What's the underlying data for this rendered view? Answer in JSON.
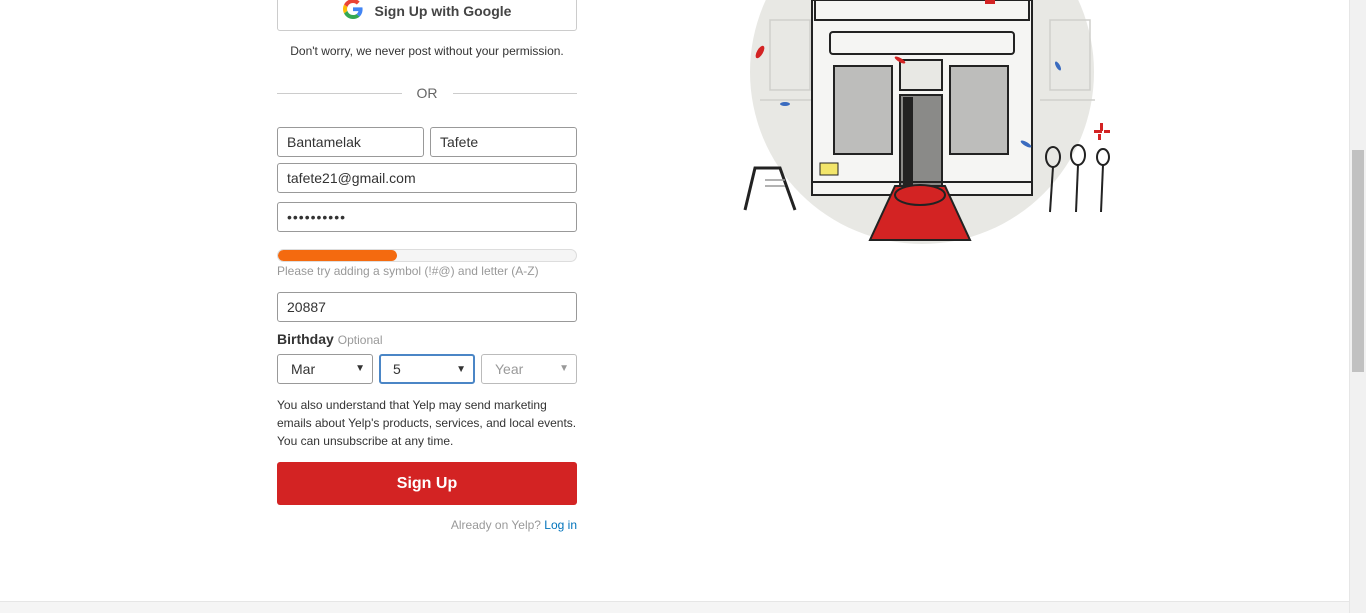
{
  "google": {
    "label": "Sign Up with Google"
  },
  "disclaimer": "Don't worry, we never post without your permission.",
  "divider": "OR",
  "form": {
    "first_name": "Bantamelak",
    "last_name": "Tafete",
    "email": "tafete21@gmail.com",
    "password": "••••••••••",
    "password_strength": 0.4,
    "strength_hint": "Please try adding a symbol (!#@) and letter (A-Z)",
    "zip": "20887"
  },
  "birthday": {
    "label": "Birthday",
    "optional": "Optional",
    "month": "Mar",
    "day": "5",
    "year_placeholder": "Year"
  },
  "marketing_text": "You also understand that Yelp may send marketing emails about Yelp's products, services, and local events. You can unsubscribe at any time.",
  "signup_label": "Sign Up",
  "already": {
    "text": "Already on Yelp?",
    "link": "Log in"
  },
  "colors": {
    "brand_red": "#d32323",
    "strength_orange": "#f46a0f",
    "link_blue": "#0073bb",
    "focus_blue": "#4b86c6"
  },
  "icons": {
    "google": "google-g-icon",
    "select_arrow": "caret-down-icon"
  }
}
